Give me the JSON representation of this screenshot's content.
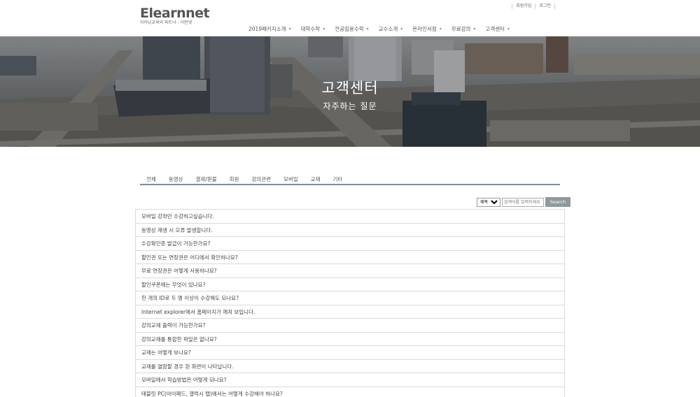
{
  "header": {
    "logo_name": "Elearnnet",
    "logo_tagline": "이러닝교육의 파트너 - 이런넷",
    "util_links": [
      "회원가입",
      "로그인"
    ],
    "nav": [
      "2019패키지소개",
      "대학수학",
      "전공임용수학",
      "교수소개",
      "온라인서점",
      "무료강의",
      "고객센터"
    ]
  },
  "hero": {
    "title": "고객센터",
    "subtitle": "자주하는 질문"
  },
  "tabs": [
    "전체",
    "동영상",
    "결제/환불",
    "회원",
    "강의관련",
    "모바일",
    "교재",
    "기타"
  ],
  "search": {
    "select_value": "제목",
    "placeholder": "검색어를 입력하세요",
    "button": "Search"
  },
  "faq": [
    "모바일 강좌만 수강하고싶습니다.",
    "동영상 재생 시 오류 발생합니다.",
    "수강확인증 발급이 가능한가요?",
    "할인권 또는 연장권은 어디에서 확인하나요?",
    "무료 연장권은 어떻게 사용하나요?",
    "할인쿠폰에는 무엇이 있나요?",
    "한 개의 ID로 두 명 이상이 수강해도 되나요?",
    "Internet explorer에서 홈페이지가 깨져 보입니다.",
    "강의교재 출력이 가능한가요?",
    "강의교재를 통합한 파일은 없나요?",
    "교재는 어떻게 보나요?",
    "교재를 열람할 경우 흰 화면이 나타납니다.",
    "모바일에서 학습방법은 어떻게 되나요?",
    "태블릿 PC(아이패드, 갤럭시 탭)에서는 어떻게 수강해야 하나요?"
  ]
}
